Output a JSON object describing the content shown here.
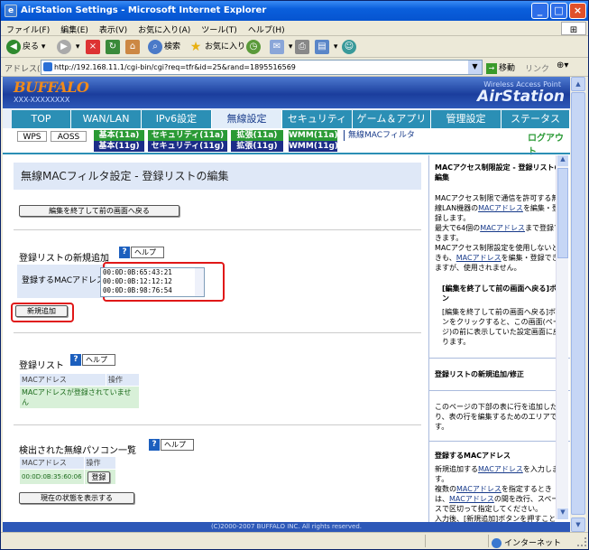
{
  "window": {
    "title": "AirStation Settings - Microsoft Internet Explorer"
  },
  "menubar": {
    "items": [
      "ファイル(F)",
      "編集(E)",
      "表示(V)",
      "お気に入り(A)",
      "ツール(T)",
      "ヘルプ(H)"
    ]
  },
  "toolbar": {
    "back": "戻る",
    "search": "検索",
    "favorites": "お気に入り"
  },
  "addressbar": {
    "label": "アドレス(D)",
    "url": "http://192.168.11.1/cgi-bin/cgi?req=tfr&id=25&rand=1895516569",
    "go": "移動",
    "links": "リンク"
  },
  "header": {
    "logo": "BUFFALO",
    "model": "XXX-XXXXXXXX",
    "tagline": "Wireless Access Point",
    "brand": "AirStation"
  },
  "nav": {
    "tabs": [
      "TOP",
      "WAN/LAN",
      "IPv6設定",
      "無線設定",
      "セキュリティ",
      "ゲーム＆アプリ",
      "管理設定",
      "ステータス"
    ],
    "active_index": 3
  },
  "subnav": {
    "wps": "WPS",
    "aoss": "AOSS",
    "basic_a": "基本(11a)",
    "basic_g": "基本(11g)",
    "sec_a": "セキュリティ(11a)",
    "sec_g": "セキュリティ(11g)",
    "ext_a": "拡張(11a)",
    "ext_g": "拡張(11g)",
    "wmm_a": "WMM(11a)",
    "wmm_g": "WMM(11g)",
    "macfilter": "無線MACフィルタ",
    "logout": "ログアウト"
  },
  "main": {
    "page_title": "無線MACフィルタ設定 - 登録リストの編集",
    "back_button": "編集を終了して前の画面へ戻る",
    "add_section_title": "登録リストの新規追加",
    "help_label": "ヘルプ",
    "mac_label": "登録するMACアドレス",
    "mac_lines": [
      "00:0D:0B:65:43:21",
      "00:0D:0B:12:12:12",
      "00:0D:0B:98:76:54"
    ],
    "add_button": "新規追加",
    "list_section_title": "登録リスト",
    "list_headers": [
      "MACアドレス",
      "操作"
    ],
    "list_empty": "MACアドレスが登録されていません",
    "detect_section_title": "検出された無線パソコン一覧",
    "detect_headers": [
      "MACアドレス",
      "操作"
    ],
    "detect_mac": "00:0D:0B:35:60:06",
    "register_button": "登録",
    "show_status_button": "現在の状態を表示する"
  },
  "side": {
    "h1": "MACアクセス制限設定 - 登録リストの編集",
    "p1a": "MACアクセス制限で通信を許可する無線LAN機器の",
    "p1link": "MACアドレス",
    "p1b": "を編集・登録します。",
    "p2a": "最大で64個の",
    "p2link": "MACアドレス",
    "p2b": "まで登録できます。",
    "p3a": "MACアクセス制限設定を使用しないときも、",
    "p3link": "MACアドレス",
    "p3b": "を編集・登録できますが、使用されません。",
    "h2": "[編集を終了して前の画面へ戻る]ボタン",
    "p4": "[編集を終了して前の画面へ戻る]ボタンをクリックすると、この画面(ページ)の前に表示していた設定画面に戻ります。",
    "h3": "登録リストの新規追加/修正",
    "p5": "このページの下部の表に行を追加したり、表の行を編集するためのエリアです。",
    "h4": "登録するMACアドレス",
    "p6a": "新規追加する",
    "p6link": "MACアドレス",
    "p6b": "を入力します。",
    "p7a": "複数の",
    "p7link": "MACアドレス",
    "p7b": "を指定するときは、",
    "p7link2": "MACアドレス",
    "p7c": "の間を改行、スペースで区切って指定してください。",
    "p8": "入力後、[新規追加]ボタンを押すこと"
  },
  "footer": {
    "copyright": "(C)2000-2007 BUFFALO INC. All rights reserved."
  },
  "status": {
    "zone": "インターネット"
  }
}
